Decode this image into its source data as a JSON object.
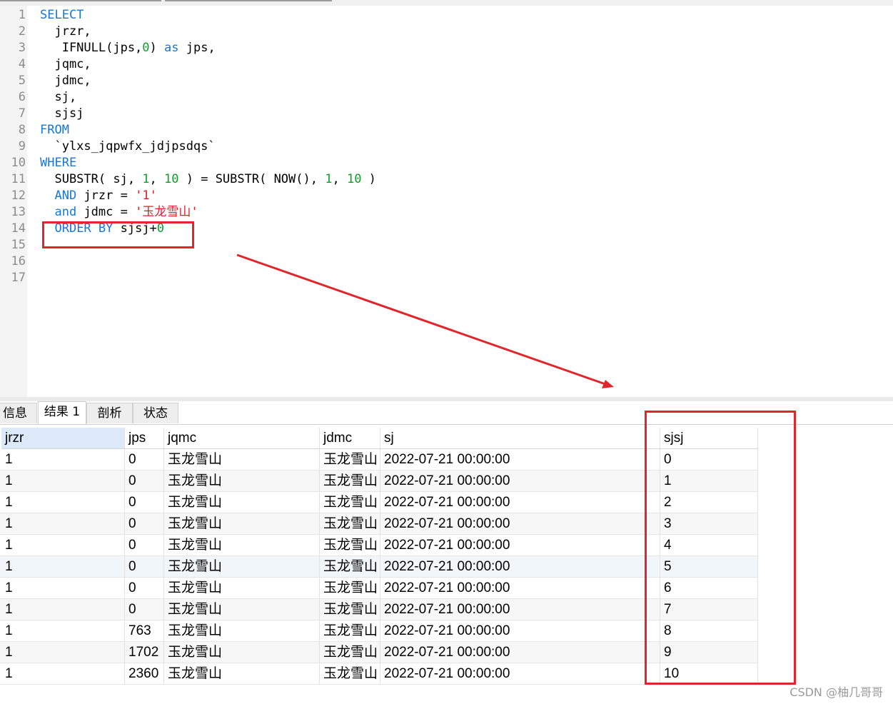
{
  "editor": {
    "line_numbers": [
      "1",
      "2",
      "3",
      "4",
      "5",
      "6",
      "7",
      "8",
      "9",
      "10",
      "11",
      "12",
      "13",
      "14",
      "15",
      "16",
      "17"
    ],
    "lines": [
      [
        {
          "t": "SELECT",
          "c": "kw"
        }
      ],
      [
        {
          "t": "  jrzr,",
          "c": ""
        }
      ],
      [
        {
          "t": "   IFNULL(jps,",
          "c": ""
        },
        {
          "t": "0",
          "c": "num"
        },
        {
          "t": ") ",
          "c": ""
        },
        {
          "t": "as",
          "c": "kw"
        },
        {
          "t": " jps,",
          "c": ""
        }
      ],
      [
        {
          "t": "  jqmc,",
          "c": ""
        }
      ],
      [
        {
          "t": "  jdmc,",
          "c": ""
        }
      ],
      [
        {
          "t": "  sj,",
          "c": ""
        }
      ],
      [
        {
          "t": "  sjsj",
          "c": ""
        }
      ],
      [
        {
          "t": "FROM",
          "c": "kw"
        }
      ],
      [
        {
          "t": "  `ylxs_jqpwfx_jdjpsdqs`",
          "c": ""
        }
      ],
      [
        {
          "t": "WHERE",
          "c": "kw"
        }
      ],
      [
        {
          "t": "  SUBSTR( sj, ",
          "c": ""
        },
        {
          "t": "1",
          "c": "num"
        },
        {
          "t": ", ",
          "c": ""
        },
        {
          "t": "10",
          "c": "num"
        },
        {
          "t": " ) = SUBSTR( NOW(), ",
          "c": ""
        },
        {
          "t": "1",
          "c": "num"
        },
        {
          "t": ", ",
          "c": ""
        },
        {
          "t": "10",
          "c": "num"
        },
        {
          "t": " )",
          "c": ""
        }
      ],
      [
        {
          "t": "  ",
          "c": ""
        },
        {
          "t": "AND",
          "c": "kw"
        },
        {
          "t": " jrzr = ",
          "c": ""
        },
        {
          "t": "'1'",
          "c": "str"
        }
      ],
      [
        {
          "t": "  ",
          "c": ""
        },
        {
          "t": "and",
          "c": "kw"
        },
        {
          "t": " jdmc = ",
          "c": ""
        },
        {
          "t": "'玉龙雪山'",
          "c": "str"
        }
      ],
      [
        {
          "t": "  ",
          "c": ""
        },
        {
          "t": "ORDER BY",
          "c": "kw"
        },
        {
          "t": " sjsj+",
          "c": ""
        },
        {
          "t": "0",
          "c": "num"
        }
      ],
      [],
      [],
      []
    ]
  },
  "tabs": [
    {
      "label": "信息",
      "active": false
    },
    {
      "label": "结果 1",
      "active": true
    },
    {
      "label": "剖析",
      "active": false
    },
    {
      "label": "状态",
      "active": false
    }
  ],
  "results": {
    "columns": [
      "jrzr",
      "jps",
      "jqmc",
      "jdmc",
      "sj",
      "sjsj"
    ],
    "rows": [
      [
        "1",
        "0",
        "玉龙雪山",
        "玉龙雪山",
        "2022-07-21 00:00:00",
        "0"
      ],
      [
        "1",
        "0",
        "玉龙雪山",
        "玉龙雪山",
        "2022-07-21 00:00:00",
        "1"
      ],
      [
        "1",
        "0",
        "玉龙雪山",
        "玉龙雪山",
        "2022-07-21 00:00:00",
        "2"
      ],
      [
        "1",
        "0",
        "玉龙雪山",
        "玉龙雪山",
        "2022-07-21 00:00:00",
        "3"
      ],
      [
        "1",
        "0",
        "玉龙雪山",
        "玉龙雪山",
        "2022-07-21 00:00:00",
        "4"
      ],
      [
        "1",
        "0",
        "玉龙雪山",
        "玉龙雪山",
        "2022-07-21 00:00:00",
        "5"
      ],
      [
        "1",
        "0",
        "玉龙雪山",
        "玉龙雪山",
        "2022-07-21 00:00:00",
        "6"
      ],
      [
        "1",
        "0",
        "玉龙雪山",
        "玉龙雪山",
        "2022-07-21 00:00:00",
        "7"
      ],
      [
        "1",
        "763",
        "玉龙雪山",
        "玉龙雪山",
        "2022-07-21 00:00:00",
        "8"
      ],
      [
        "1",
        "1702",
        "玉龙雪山",
        "玉龙雪山",
        "2022-07-21 00:00:00",
        "9"
      ],
      [
        "1",
        "2360",
        "玉龙雪山",
        "玉龙雪山",
        "2022-07-21 00:00:00",
        "10"
      ]
    ]
  },
  "annotation_color": "#e0262b",
  "watermark": "CSDN @柚几哥哥"
}
